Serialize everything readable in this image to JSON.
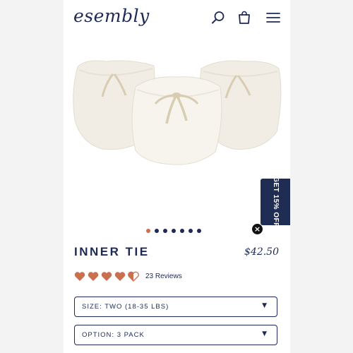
{
  "header": {
    "logo": "esembly",
    "search_icon": "search-icon",
    "bag_icon": "bag-icon",
    "menu_icon": "hamburger-menu-icon"
  },
  "promo": {
    "label": "GET 15% OFF",
    "close_icon": "close-icon"
  },
  "carousel": {
    "dot_count": 7,
    "active_index": 0
  },
  "product": {
    "title": "INNER TIE",
    "price": "$42.50",
    "rating": 4.5,
    "rating_max": 5,
    "reviews_label": "23 Reviews"
  },
  "options": {
    "size_label": "SIZE: TWO (18-35 LBS)",
    "option_label": "OPTION: 3 PACK",
    "arrow_icon": "triangle-down-icon"
  },
  "colors": {
    "navy": "#1e2a55",
    "heart": "#c8704f",
    "active_dot": "#c8704f",
    "promo_bg": "#1f2d55"
  }
}
